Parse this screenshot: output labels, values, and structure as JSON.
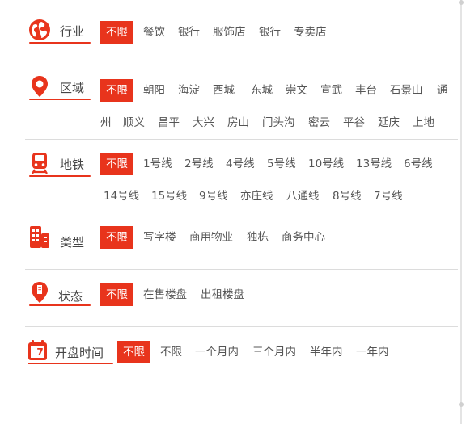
{
  "colors": {
    "accent": "#e8341c",
    "divider": "#dcdcdc",
    "text": "#555555"
  },
  "filters": [
    {
      "id": "industry",
      "label": "行业",
      "icon": "globe-icon",
      "options": [
        "不限",
        "餐饮",
        "银行",
        "服饰店",
        "银行",
        "专卖店"
      ]
    },
    {
      "id": "district",
      "label": "区域",
      "icon": "map-pin-icon",
      "options": [
        "不限",
        "朝阳",
        "海淀",
        "西城",
        "东城",
        "崇文",
        "宣武",
        "丰台",
        "石景山",
        "通",
        "州",
        "顺义",
        "昌平",
        "大兴",
        "房山",
        "门头沟",
        "密云",
        "平谷",
        "延庆",
        "上地"
      ]
    },
    {
      "id": "subway",
      "label": "地铁",
      "icon": "subway-train-icon",
      "options": [
        "不限",
        "1号线",
        "2号线",
        "4号线",
        "5号线",
        "10号线",
        "13号线",
        "6号线",
        "14号线",
        "15号线",
        "9号线",
        "亦庄线",
        "八通线",
        "8号线",
        "7号线"
      ]
    },
    {
      "id": "type",
      "label": "类型",
      "icon": "office-building-icon",
      "options": [
        "不限",
        "写字楼",
        "商用物业",
        "独栋",
        "商务中心"
      ]
    },
    {
      "id": "status",
      "label": "状态",
      "icon": "status-pin-icon",
      "options": [
        "不限",
        "在售楼盘",
        "出租楼盘"
      ]
    },
    {
      "id": "open_time",
      "label": "开盘时间",
      "icon": "calendar-icon",
      "calendar_day": "7",
      "options": [
        "不限",
        "不限",
        "一个月内",
        "三个月内",
        "半年内",
        "一年内"
      ]
    }
  ]
}
